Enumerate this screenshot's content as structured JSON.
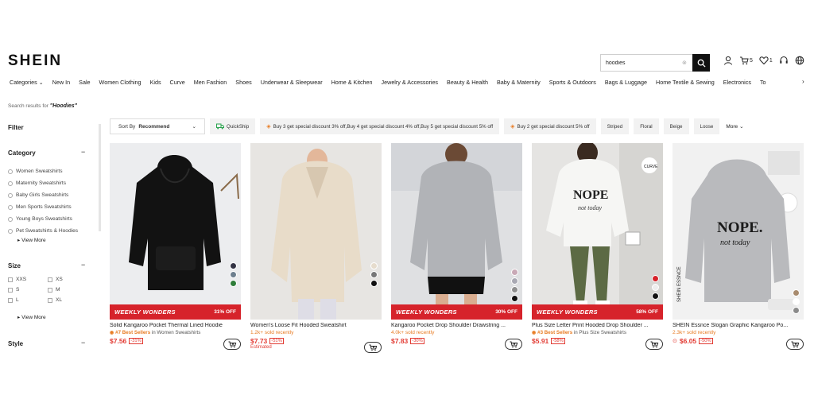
{
  "header": {
    "logo": "SHEIN",
    "search_value": "hoodies",
    "cart_count": "5",
    "wishlist_count": "1"
  },
  "nav": {
    "items": [
      "Categories ⌄",
      "New In",
      "Sale",
      "Women Clothing",
      "Kids",
      "Curve",
      "Men Fashion",
      "Shoes",
      "Underwear & Sleepwear",
      "Home & Kitchen",
      "Jewelry & Accessories",
      "Beauty & Health",
      "Baby & Maternity",
      "Sports & Outdoors",
      "Bags & Luggage",
      "Home Textile & Sewing",
      "Electronics",
      "To"
    ]
  },
  "results": {
    "prefix": "Search results for",
    "query": "\"Hoodies\""
  },
  "sidebar": {
    "filter": "Filter",
    "category_title": "Category",
    "categories": [
      "Women Sweatshirts",
      "Maternity Sweatshirts",
      "Baby Girls Sweatshirts",
      "Men Sports Sweatshirts",
      "Young Boys Sweatshirts",
      "Pet Sweatshirts & Hoodies"
    ],
    "view_more": "View More",
    "size_title": "Size",
    "sizes": [
      "XXS",
      "XS",
      "S",
      "M",
      "L",
      "XL"
    ],
    "style_title": "Style"
  },
  "sortbar": {
    "sort_by": "Sort By",
    "sort_value": "Recommend",
    "quickship": "QuickShip",
    "promo1": "Buy 3 get special discount 3% off,Buy 4 get special discount 4% off,Buy 5 get special discount 5% off",
    "promo2": "Buy 2 get special discount 5% off",
    "chips": [
      "Striped",
      "Floral",
      "Beige",
      "Loose"
    ],
    "more": "More"
  },
  "products": [
    {
      "title": "Solid Kangaroo Pocket Thermal Lined Hoodie",
      "banner": "WEEKLY WONDERS",
      "off": "31% OFF",
      "badge_hl": "#7 Best Sellers",
      "badge_rest": "in Women Sweatshirts",
      "sold": "",
      "price": "$7.56",
      "discount": "-31%",
      "estimated": "",
      "swatches": [
        "#333344",
        "#6d7f8f",
        "#2e7d3a"
      ]
    },
    {
      "title": "Women's Loose Fit Hooded Sweatshirt",
      "banner": "",
      "off": "",
      "badge_hl": "",
      "badge_rest": "",
      "sold": "1.2k+ sold recently",
      "price": "$7.73",
      "discount": "-51%",
      "estimated": "Estimated",
      "swatches": [
        "#e6dccd",
        "#777777",
        "#111111"
      ]
    },
    {
      "title": "Kangaroo Pocket Drop Shoulder Drawstring ...",
      "banner": "WEEKLY WONDERS",
      "off": "30% OFF",
      "badge_hl": "",
      "badge_rest": "",
      "sold": "4.0k+ sold recently",
      "price": "$7.83",
      "discount": "-30%",
      "estimated": "",
      "swatches": [
        "#c9a9b6",
        "#a9a9b3",
        "#8f8f8f",
        "#111111"
      ]
    },
    {
      "title": "Plus Size Letter Print Hooded Drop Shoulder ...",
      "banner": "WEEKLY WONDERS",
      "off": "58% OFF",
      "badge_hl": "#3 Best Sellers",
      "badge_rest": "in Plus Size Sweatshirts",
      "sold": "",
      "price": "$5.91",
      "discount": "-58%",
      "estimated": "",
      "swatches": [
        "#d6232b",
        "#eeeeee",
        "#111111"
      ]
    },
    {
      "title": "SHEIN Essnce Slogan Graphic Kangaroo Po...",
      "banner": "",
      "off": "",
      "badge_hl": "",
      "badge_rest": "",
      "sold": "2.3k+ sold recently",
      "price": "$6.05",
      "discount": "-50%",
      "estimated": "",
      "swatches": [
        "#a88b6e",
        "#ffffff",
        "#8b8b8b"
      ]
    }
  ]
}
